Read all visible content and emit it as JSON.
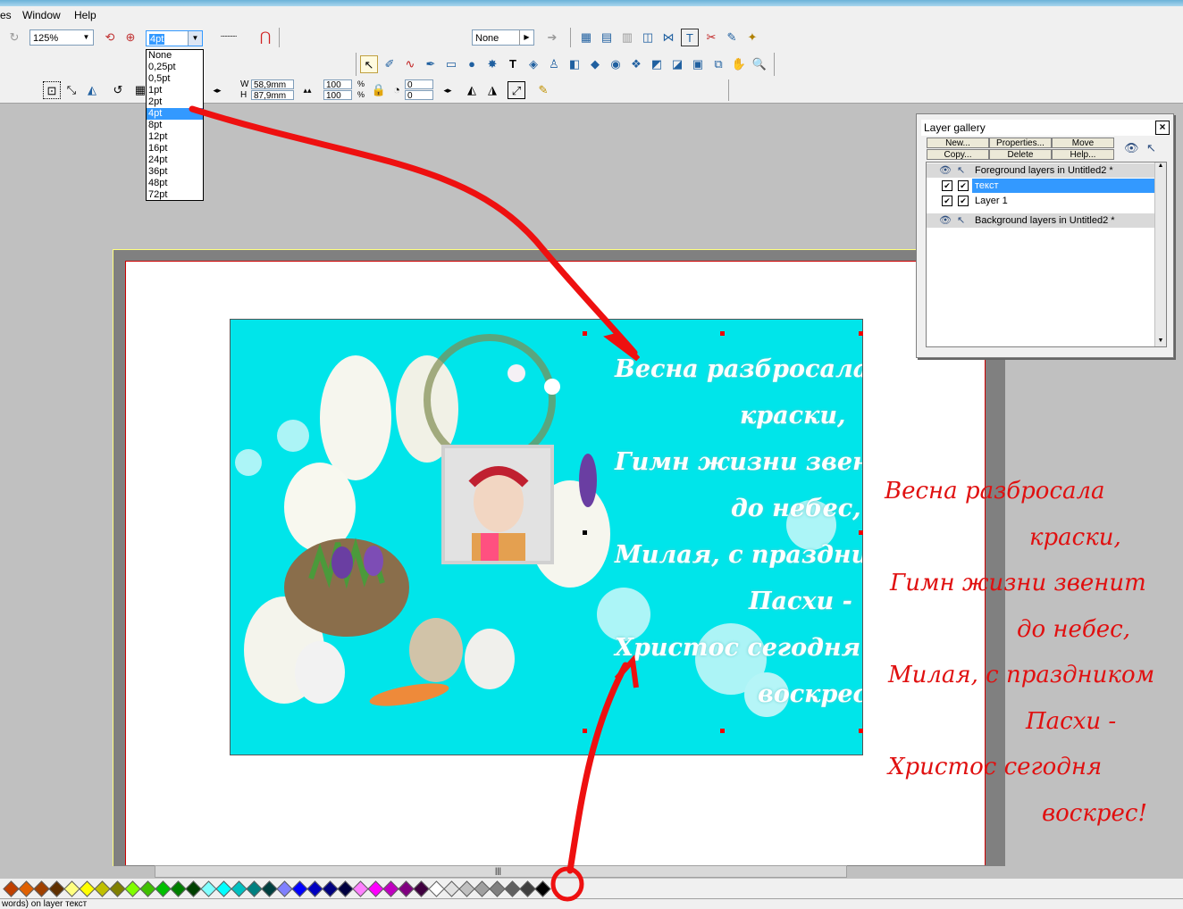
{
  "menubar": {
    "items": [
      "es",
      "Window",
      "Help"
    ]
  },
  "toolbar": {
    "zoom_value": "125%",
    "line_width_value": "4pt",
    "arrow_none_value": "None",
    "width_label": "W",
    "height_label": "H",
    "width_value": "58,9mm",
    "height_value": "87,9mm",
    "scale_x": "100",
    "scale_y": "100",
    "percent_x": "%",
    "percent_y": "%",
    "rotate_value": "0",
    "skew_value": "0"
  },
  "line_width_dropdown": {
    "options": [
      "None",
      "0,25pt",
      "0,5pt",
      "1pt",
      "2pt",
      "4pt",
      "8pt",
      "12pt",
      "16pt",
      "24pt",
      "36pt",
      "48pt",
      "72pt"
    ],
    "selected": "4pt"
  },
  "layer_gallery": {
    "title": "Layer gallery",
    "buttons": {
      "new": "New...",
      "properties": "Properties...",
      "move": "Move",
      "copy": "Copy...",
      "delete": "Delete",
      "help": "Help..."
    },
    "rows": [
      {
        "label": "Foreground layers in Untitled2 *"
      },
      {
        "label": "текст"
      },
      {
        "label": "Layer 1"
      },
      {
        "label": "Background layers in Untitled2 *"
      }
    ]
  },
  "card_poem": {
    "lines": [
      "Весна разбросала",
      "краски,",
      "Гимн жизни звенит",
      "до небес,",
      "Милая, с праздником",
      "Пасхи -",
      "Христос сегодня",
      "воскрес!"
    ]
  },
  "red_poem": {
    "lines": [
      "Весна разбросала",
      "краски,",
      "Гимн жизни звенит",
      "до небес,",
      "Милая, с праздником",
      "Пасхи -",
      "Христос сегодня",
      "воскрес!"
    ]
  },
  "statusbar": {
    "text": "words) on layer текст"
  },
  "colors": {
    "card_background": "#00e5ea",
    "annotation_red": "#e01010",
    "selection_blue": "#3399ff",
    "palette": [
      "#c04000",
      "#e06000",
      "#a04000",
      "#603000",
      "#ffff80",
      "#ffff00",
      "#c0c000",
      "#808000",
      "#80ff00",
      "#40c000",
      "#00c000",
      "#008000",
      "#004000",
      "#80ffff",
      "#00ffff",
      "#00c0c0",
      "#008080",
      "#004040",
      "#8080ff",
      "#0000ff",
      "#0000c0",
      "#000080",
      "#000040",
      "#ff80ff",
      "#ff00ff",
      "#c000c0",
      "#800080",
      "#400040",
      "#ffffff",
      "#e0e0e0",
      "#c0c0c0",
      "#a0a0a0",
      "#808080",
      "#606060",
      "#404040",
      "#000000"
    ]
  }
}
